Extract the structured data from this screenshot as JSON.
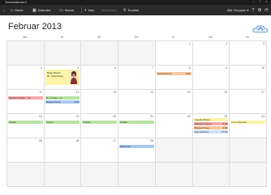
{
  "window": {
    "title": "Terminkalender3",
    "controls": [
      "–",
      "□",
      "×"
    ]
  },
  "toolbar": {
    "back": "←",
    "items": [
      {
        "label": "Home",
        "icon": "home-icon",
        "glyph": "⌂"
      },
      {
        "label": "Kalender",
        "icon": "calendar-icon",
        "glyph": "▦"
      },
      {
        "label": "Monat",
        "icon": "month-view-icon",
        "glyph": "▭"
      },
      {
        "label": "Neu",
        "icon": "add-icon",
        "glyph": "+"
      },
      {
        "label": "Bearbeiten",
        "icon": "",
        "glyph": ""
      },
      {
        "label": "Suchen",
        "icon": "search-icon",
        "glyph": "⚲"
      }
    ],
    "filter": "Alle Gruppen ▾",
    "right_glyphs": [
      "?",
      "⚙",
      "⟳"
    ]
  },
  "calendar": {
    "month_title": "Februar 2013",
    "weekdays": [
      "Mo",
      "Di",
      "Mi",
      "Do",
      "Fr",
      "Sa",
      "So"
    ],
    "weeks": [
      [
        {
          "day": "",
          "events": []
        },
        {
          "day": "",
          "events": []
        },
        {
          "day": "",
          "events": []
        },
        {
          "day": "",
          "events": []
        },
        {
          "day": "1",
          "events": []
        },
        {
          "day": "2",
          "events": []
        },
        {
          "day": "3",
          "events": []
        }
      ],
      [
        {
          "day": "4",
          "events": []
        },
        {
          "day": "5",
          "birthday": {
            "line1": "Mady Muster",
            "line2": "30. Geburtstag"
          },
          "events": []
        },
        {
          "day": "6",
          "events": []
        },
        {
          "day": "7",
          "events": []
        },
        {
          "day": "8",
          "events": [
            {
              "text": "Friseurtermin",
              "time": "8:00",
              "color": "orange"
            }
          ]
        },
        {
          "day": "9",
          "events": []
        },
        {
          "day": "10",
          "events": []
        }
      ],
      [
        {
          "day": "11",
          "events": [
            {
              "text": "Manfred Muste... 40",
              "time": "",
              "color": "pink"
            }
          ]
        },
        {
          "day": "12",
          "events": [
            {
              "text": "Flm & Sam. 1t...",
              "time": "",
              "color": "green"
            },
            {
              "text": "Besprechung",
              "time": "9:00",
              "color": "blue"
            }
          ]
        },
        {
          "day": "13",
          "events": []
        },
        {
          "day": "14",
          "events": []
        },
        {
          "day": "15",
          "events": []
        },
        {
          "day": "16",
          "events": []
        },
        {
          "day": "17",
          "events": []
        }
      ],
      [
        {
          "day": "18",
          "events": [
            {
              "text": "Urlaub",
              "time": "",
              "color": "green"
            }
          ]
        },
        {
          "day": "19",
          "events": [
            {
              "text": "Urlaub",
              "time": "",
              "color": "green"
            }
          ]
        },
        {
          "day": "20",
          "events": [
            {
              "text": "Urlaub",
              "time": "",
              "color": "green"
            }
          ]
        },
        {
          "day": "21",
          "events": [
            {
              "text": "Urlaub",
              "time": "",
              "color": "green"
            }
          ]
        },
        {
          "day": "22",
          "events": []
        },
        {
          "day": "23",
          "events": [
            {
              "text": "Claudia Muste...",
              "time": "",
              "color": "yellow"
            },
            {
              "text": "Zahnarzt kontro...",
              "time": "8:00",
              "color": "pink"
            },
            {
              "text": "Besprechung ...",
              "time": "9:00",
              "color": "orange"
            },
            {
              "text": "Auto abholen",
              "time": "17:00",
              "color": "lblue"
            }
          ]
        },
        {
          "day": "24",
          "events": [
            {
              "text": "Foto Opposite ...",
              "time": "",
              "color": "yellow"
            }
          ]
        }
      ],
      [
        {
          "day": "25",
          "events": []
        },
        {
          "day": "26",
          "events": []
        },
        {
          "day": "27",
          "events": []
        },
        {
          "day": "28",
          "events": [
            {
              "text": "Elektrisch",
              "time": "",
              "color": "blue"
            }
          ]
        },
        {
          "day": "",
          "events": []
        },
        {
          "day": "",
          "events": []
        },
        {
          "day": "",
          "events": []
        }
      ],
      [
        {
          "day": "",
          "events": []
        },
        {
          "day": "",
          "events": []
        },
        {
          "day": "",
          "events": []
        },
        {
          "day": "",
          "events": []
        },
        {
          "day": "",
          "events": []
        },
        {
          "day": "",
          "events": []
        },
        {
          "day": "",
          "events": []
        }
      ]
    ]
  }
}
